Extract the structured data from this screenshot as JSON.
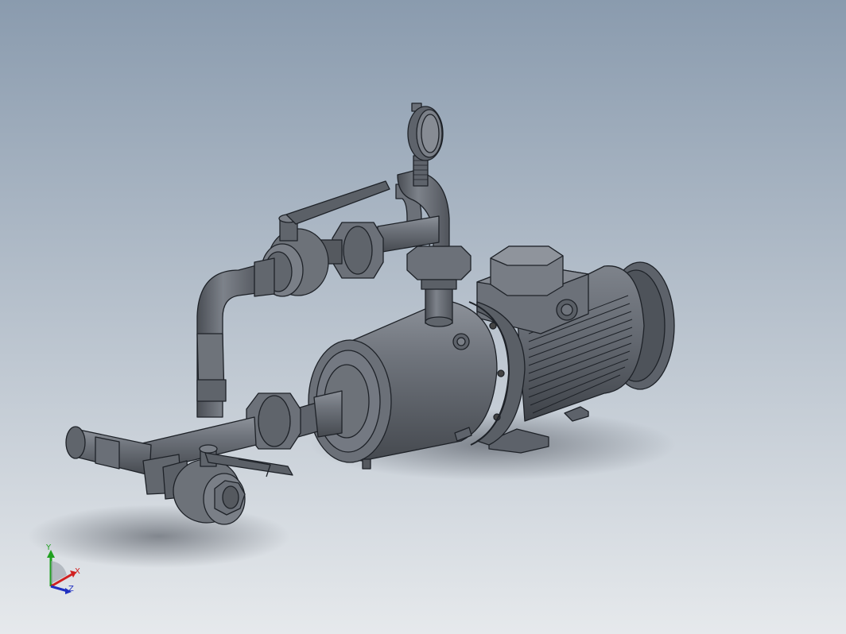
{
  "viewport": {
    "background_top": "#8a9bae",
    "background_bottom": "#e6e9ec",
    "model_color": "#6a6f78",
    "edge_color": "#1e2228"
  },
  "triad": {
    "x_label": "X",
    "y_label": "Y",
    "z_label": "Z",
    "x_color": "#d02020",
    "y_color": "#20a020",
    "z_color": "#2030c0"
  }
}
